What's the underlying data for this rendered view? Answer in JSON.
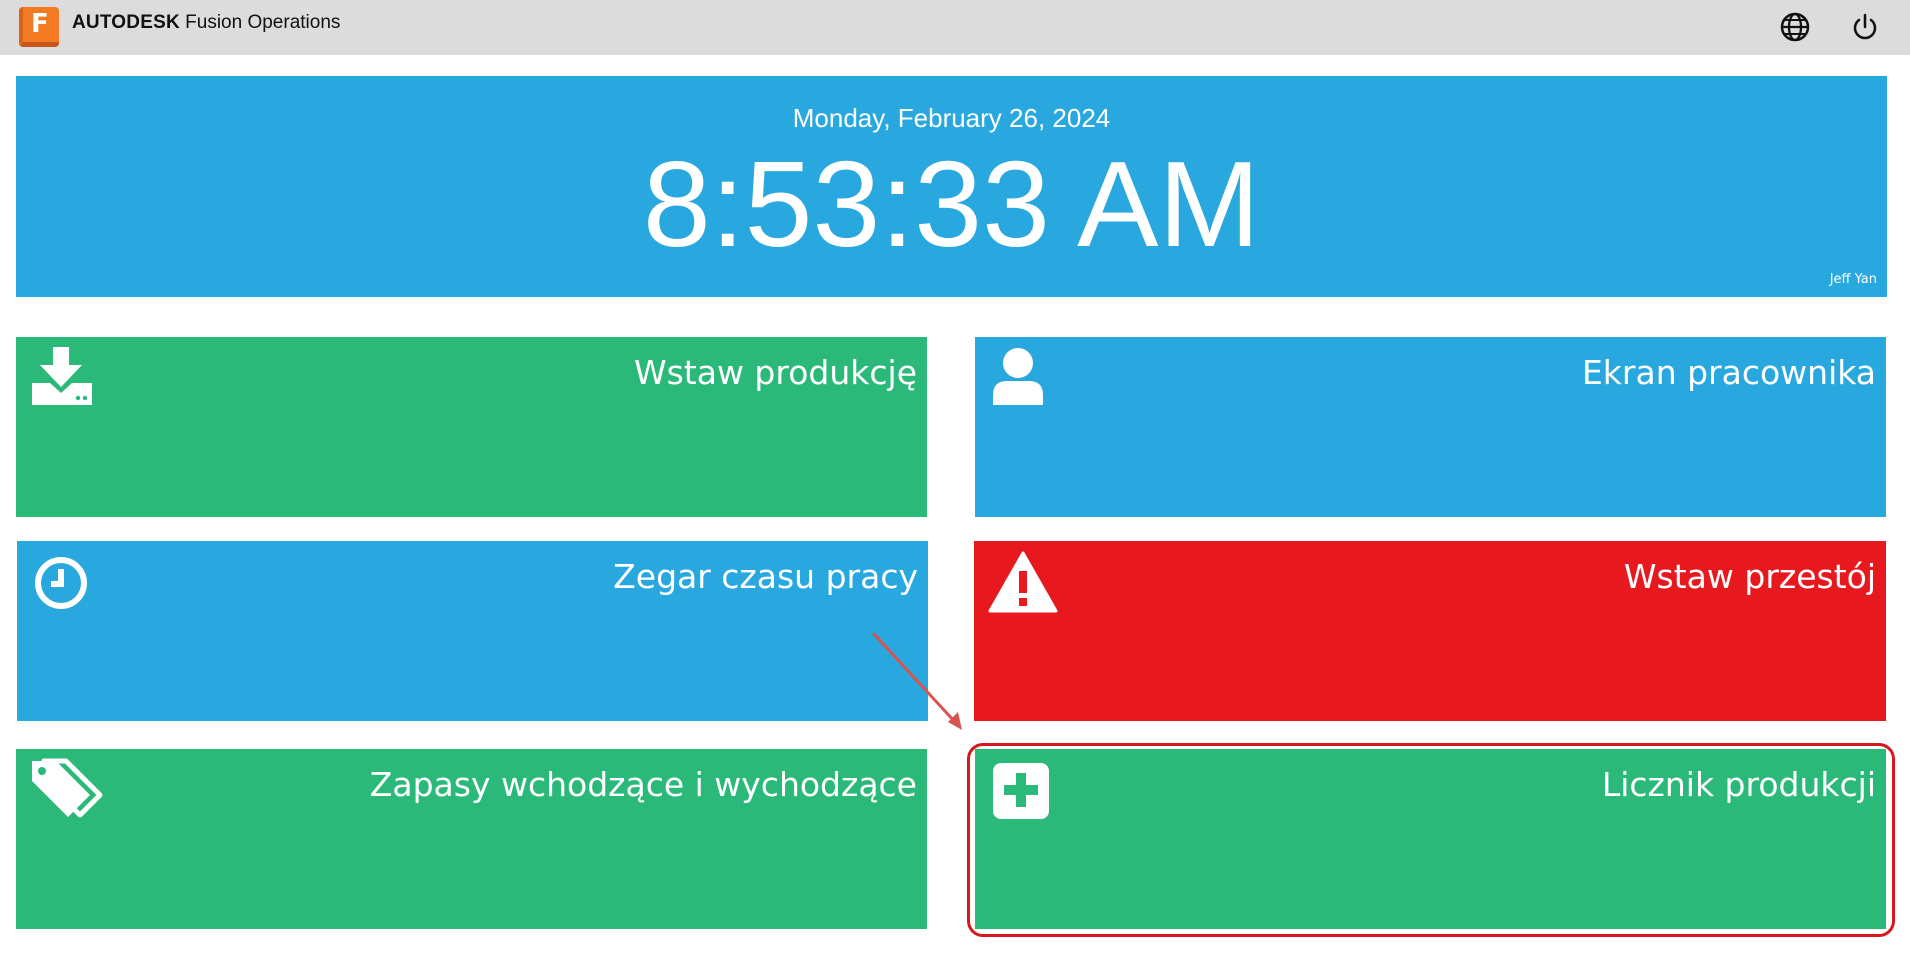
{
  "app": {
    "logo_letter": "F",
    "brand_bold": "AUTODESK",
    "brand_product": "Fusion Operations",
    "globe_icon": "globe-icon",
    "power_icon": "power-icon"
  },
  "clock": {
    "date": "Monday, February 26, 2024",
    "time": "8:53:33 AM",
    "user": "Jeff Yan"
  },
  "tiles": [
    {
      "label": "Wstaw produkcję",
      "icon": "download-icon",
      "color": "#2bb97a"
    },
    {
      "label": "Ekran pracownika",
      "icon": "user-icon",
      "color": "#29a8e0"
    },
    {
      "label": "Zegar czasu pracy",
      "icon": "clock-icon",
      "color": "#29a8e0"
    },
    {
      "label": "Wstaw przestój",
      "icon": "warning-icon",
      "color": "#e8191e"
    },
    {
      "label": "Zapasy wchodzące i wychodzące",
      "icon": "tags-icon",
      "color": "#2bb97a"
    },
    {
      "label": "Licznik produkcji",
      "icon": "plus-square-icon",
      "color": "#2bb97a"
    }
  ],
  "annotation": {
    "highlight_color": "#d6171d",
    "arrow_color": "#d9534f"
  }
}
